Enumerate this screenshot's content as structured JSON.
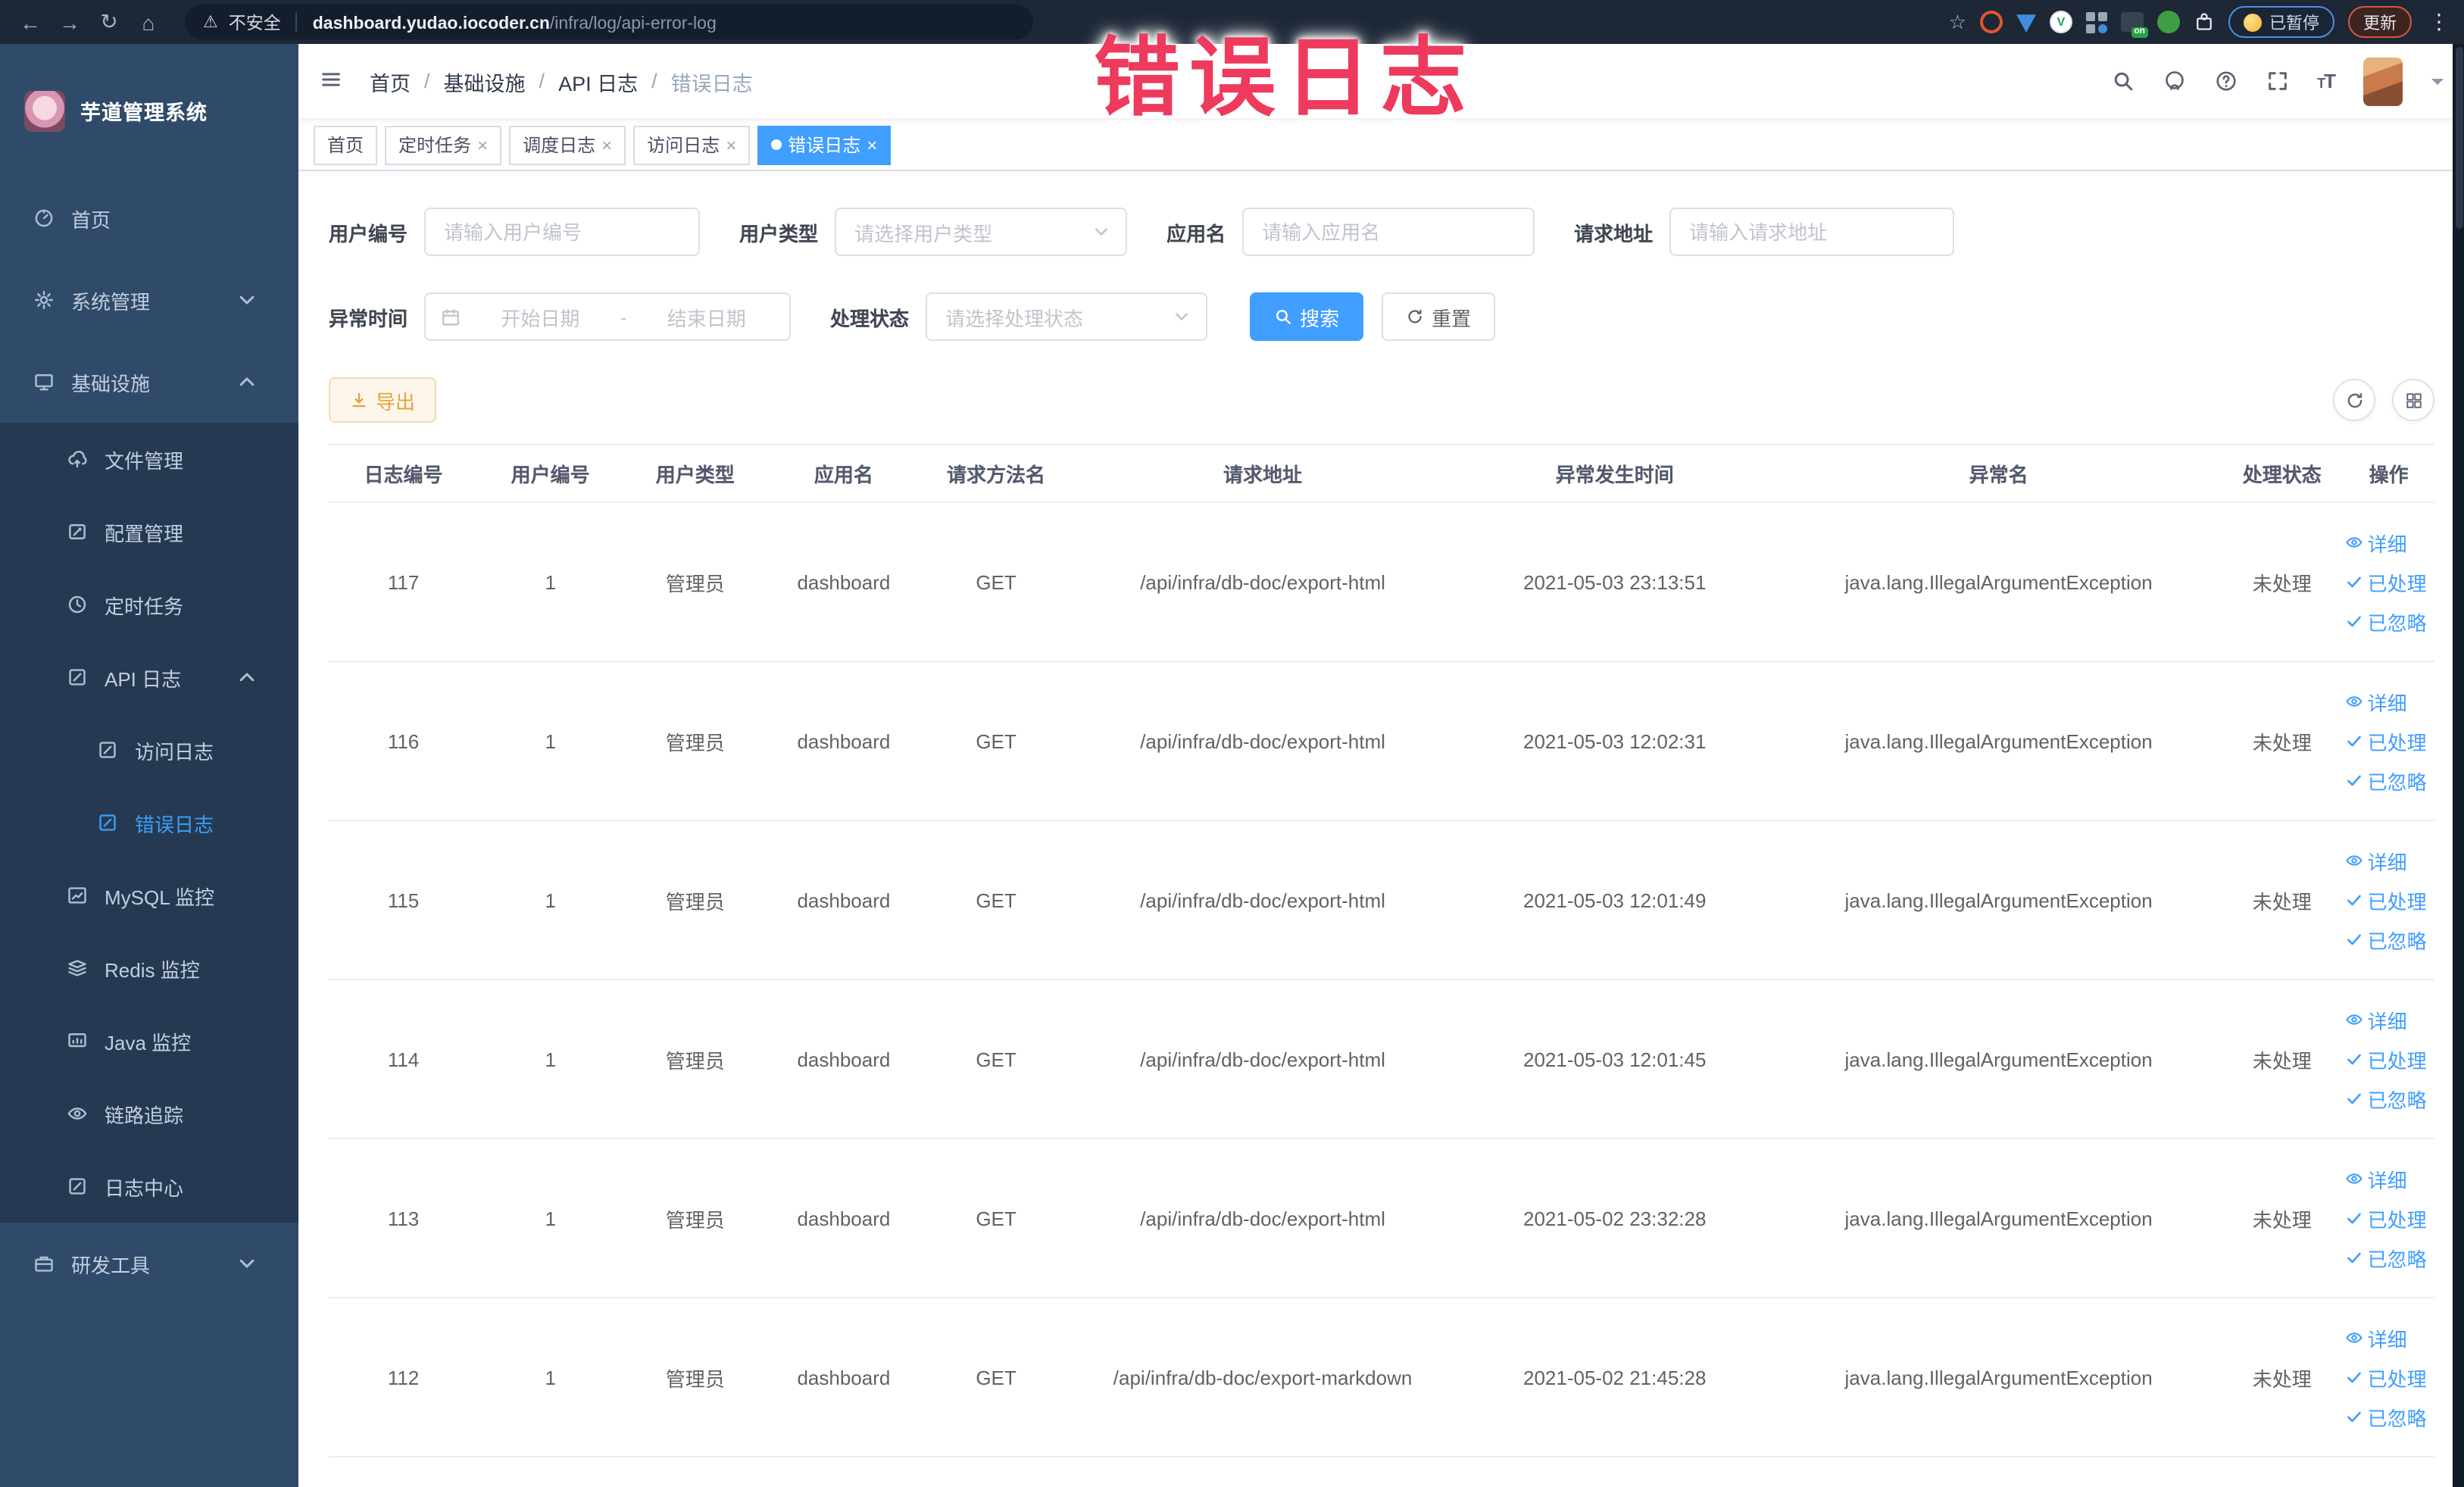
{
  "browser": {
    "security_label": "不安全",
    "url_host": "dashboard.yudao.iocoder.cn",
    "url_path": "/infra/log/api-error-log",
    "extension_badge": "on",
    "paused_chip": "已暂停",
    "update_chip": "更新"
  },
  "annotation": {
    "text": "错误日志"
  },
  "sidebar": {
    "logo_title": "芋道管理系统",
    "items": [
      {
        "label": "首页",
        "icon": "gauge"
      },
      {
        "label": "系统管理",
        "icon": "gear"
      },
      {
        "label": "基础设施",
        "icon": "monitor"
      },
      {
        "label": "文件管理",
        "icon": "cloud-up"
      },
      {
        "label": "配置管理",
        "icon": "edit"
      },
      {
        "label": "定时任务",
        "icon": "clock"
      },
      {
        "label": "API 日志",
        "icon": "doc-edit"
      },
      {
        "label": "访问日志",
        "icon": "doc-edit"
      },
      {
        "label": "错误日志",
        "icon": "doc-edit"
      },
      {
        "label": "MySQL 监控",
        "icon": "chart-board"
      },
      {
        "label": "Redis 监控",
        "icon": "layers"
      },
      {
        "label": "Java 监控",
        "icon": "screen"
      },
      {
        "label": "链路追踪",
        "icon": "eye"
      },
      {
        "label": "日志中心",
        "icon": "doc-edit"
      },
      {
        "label": "研发工具",
        "icon": "toolbox"
      }
    ]
  },
  "header": {
    "breadcrumb": [
      "首页",
      "基础设施",
      "API 日志",
      "错误日志"
    ]
  },
  "tags": [
    {
      "label": "首页"
    },
    {
      "label": "定时任务"
    },
    {
      "label": "调度日志"
    },
    {
      "label": "访问日志"
    },
    {
      "label": "错误日志"
    }
  ],
  "filters": {
    "user_id": {
      "label": "用户编号",
      "placeholder": "请输入用户编号"
    },
    "user_type": {
      "label": "用户类型",
      "placeholder": "请选择用户类型"
    },
    "app_name": {
      "label": "应用名",
      "placeholder": "请输入应用名"
    },
    "request_url": {
      "label": "请求地址",
      "placeholder": "请输入请求地址"
    },
    "exception_time": {
      "label": "异常时间",
      "start_placeholder": "开始日期",
      "separator": "-",
      "end_placeholder": "结束日期"
    },
    "process_status": {
      "label": "处理状态",
      "placeholder": "请选择处理状态"
    },
    "search_label": "搜索",
    "reset_label": "重置"
  },
  "toolbar": {
    "export_label": "导出"
  },
  "table": {
    "columns": [
      "日志编号",
      "用户编号",
      "用户类型",
      "应用名",
      "请求方法名",
      "请求地址",
      "异常发生时间",
      "异常名",
      "处理状态",
      "操作"
    ],
    "column_keys": [
      "log_id",
      "user_id",
      "user_type",
      "app_name",
      "method",
      "request_url",
      "exception_time",
      "exception_name",
      "status"
    ],
    "actions": [
      "详细",
      "已处理",
      "已忽略"
    ],
    "rows": [
      [
        "117",
        "1",
        "管理员",
        "dashboard",
        "GET",
        "/api/infra/db-doc/export-html",
        "2021-05-03 23:13:51",
        "java.lang.IllegalArgumentException",
        "未处理"
      ],
      [
        "116",
        "1",
        "管理员",
        "dashboard",
        "GET",
        "/api/infra/db-doc/export-html",
        "2021-05-03 12:02:31",
        "java.lang.IllegalArgumentException",
        "未处理"
      ],
      [
        "115",
        "1",
        "管理员",
        "dashboard",
        "GET",
        "/api/infra/db-doc/export-html",
        "2021-05-03 12:01:49",
        "java.lang.IllegalArgumentException",
        "未处理"
      ],
      [
        "114",
        "1",
        "管理员",
        "dashboard",
        "GET",
        "/api/infra/db-doc/export-html",
        "2021-05-03 12:01:45",
        "java.lang.IllegalArgumentException",
        "未处理"
      ],
      [
        "113",
        "1",
        "管理员",
        "dashboard",
        "GET",
        "/api/infra/db-doc/export-html",
        "2021-05-02 23:32:28",
        "java.lang.IllegalArgumentException",
        "未处理"
      ],
      [
        "112",
        "1",
        "管理员",
        "dashboard",
        "GET",
        "/api/infra/db-doc/export-markdown",
        "2021-05-02 21:45:28",
        "java.lang.IllegalArgumentException",
        "未处理"
      ]
    ]
  },
  "colors": {
    "accent": "#409eff",
    "warning": "#e6a23c",
    "annotation": "#ee3a5c",
    "sidebar": "#2f4b69",
    "sidebar_sub": "#253a52"
  }
}
